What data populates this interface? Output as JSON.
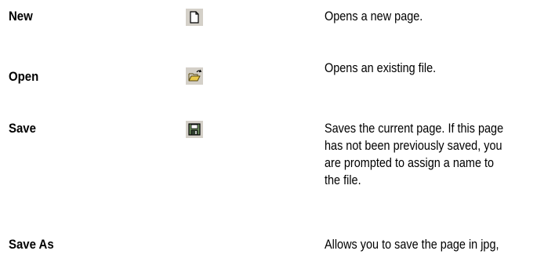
{
  "rows": [
    {
      "term": "New",
      "icon": "new-page-icon",
      "description": [
        "Opens a new page."
      ]
    },
    {
      "term": "Open",
      "icon": "open-folder-icon",
      "description": [
        "Opens an existing file."
      ]
    },
    {
      "term": "Save",
      "icon": "floppy-disk-icon",
      "description": [
        "Saves the current page. If this page",
        "has not been previously saved, you",
        "are prompted to assign a name to",
        "the file."
      ]
    },
    {
      "term": "Save As",
      "icon": "",
      "description": [
        "Allows you to save the page in jpg,"
      ]
    }
  ],
  "colors": {
    "icon_background": "#d4d0c8",
    "folder_yellow": "#e8c84a",
    "disk_green": "#6f8f5f"
  }
}
